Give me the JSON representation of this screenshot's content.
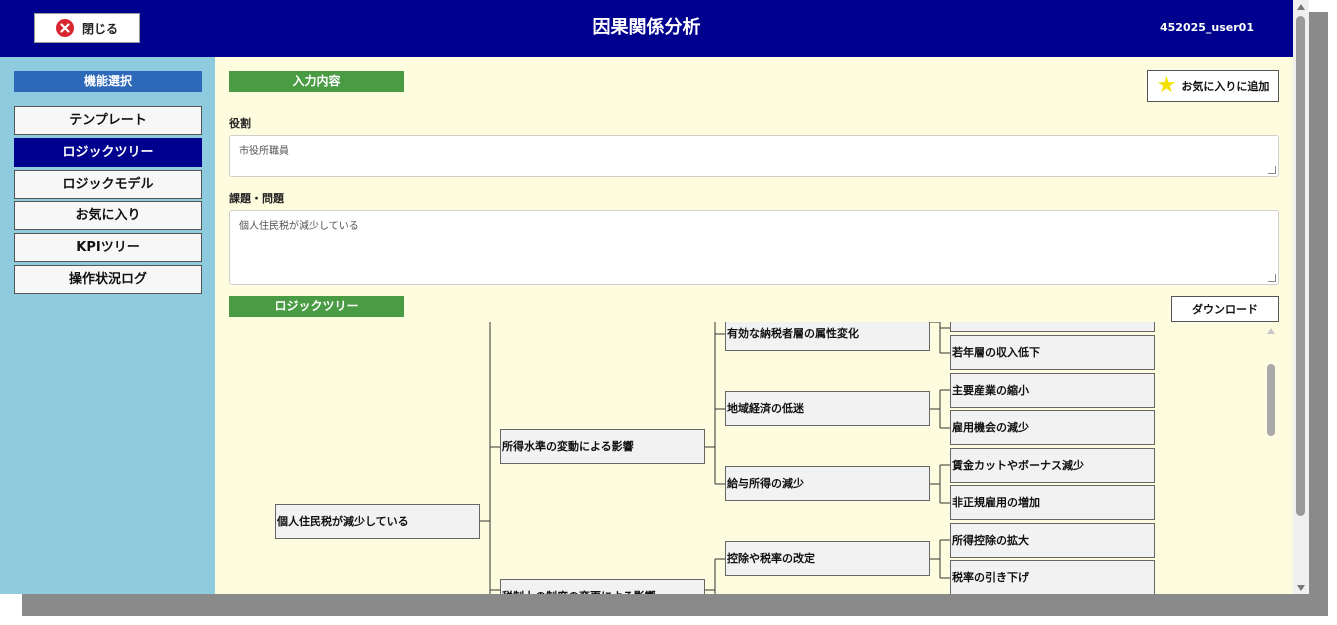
{
  "header": {
    "close_label": "閉じる",
    "title": "因果関係分析",
    "user": "452025_user01"
  },
  "sidebar": {
    "heading": "機能選択",
    "items": [
      {
        "label": "テンプレート",
        "active": false
      },
      {
        "label": "ロジックツリー",
        "active": true
      },
      {
        "label": "ロジックモデル",
        "active": false
      },
      {
        "label": "お気に入り",
        "active": false
      },
      {
        "label": "KPIツリー",
        "active": false
      },
      {
        "label": "操作状況ログ",
        "active": false
      }
    ]
  },
  "main": {
    "input_section_label": "入力内容",
    "favorite_button_label": "お気に入りに追加",
    "role_label": "役割",
    "role_value": "市役所職員",
    "issue_label": "課題・問題",
    "issue_value": "個人住民税が減少している",
    "tree_section_label": "ロジックツリー",
    "download_button_label": "ダウンロード"
  },
  "tree": {
    "root": "個人住民税が減少している",
    "level1": [
      "所得水準の変動による影響",
      "税制上の制度の変更による影響"
    ],
    "level2": [
      "有効な納税者層の属性変化",
      "地域経済の低迷",
      "給与所得の減少",
      "控除や税率の改定"
    ],
    "level3": [
      "若年層の収入低下",
      "主要産業の縮小",
      "雇用機会の減少",
      "賃金カットやボーナス減少",
      "非正規雇用の増加",
      "所得控除の拡大",
      "税率の引き下げ"
    ]
  },
  "colors": {
    "header_bg": "#00008e",
    "sidebar_bg": "#8fcbde",
    "section_bar": "#4a9c44",
    "main_bg": "#fefcde",
    "accent_blue": "#2e68b9"
  }
}
